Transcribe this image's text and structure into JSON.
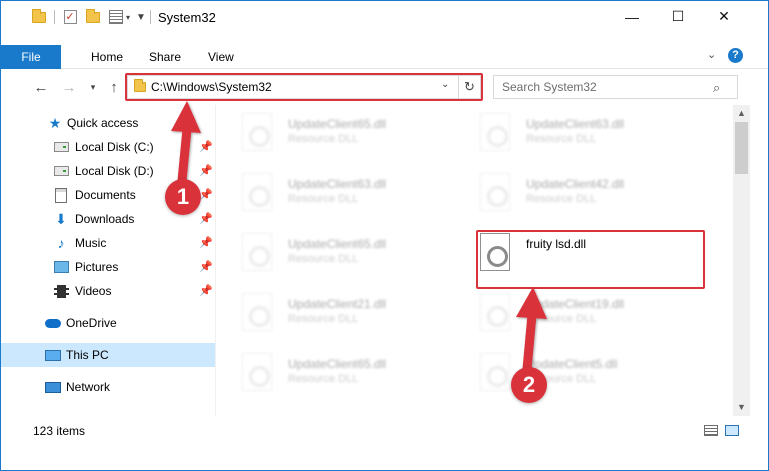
{
  "window": {
    "title": "System32",
    "controls": {
      "minimize": "—",
      "maximize": "☐",
      "close": "✕"
    }
  },
  "ribbon": {
    "tabs": [
      "File",
      "Home",
      "Share",
      "View"
    ]
  },
  "address": {
    "path": "C:\\Windows\\System32",
    "search_placeholder": "Search System32"
  },
  "sidebar": {
    "items": [
      {
        "label": "Quick access",
        "icon": "star-icon",
        "pinned": false
      },
      {
        "label": "Local Disk (C:)",
        "icon": "drive-icon",
        "pinned": true
      },
      {
        "label": "Local Disk (D:)",
        "icon": "drive-icon",
        "pinned": true
      },
      {
        "label": "Documents",
        "icon": "documents-icon",
        "pinned": true
      },
      {
        "label": "Downloads",
        "icon": "downloads-icon",
        "pinned": true
      },
      {
        "label": "Music",
        "icon": "music-icon",
        "pinned": true
      },
      {
        "label": "Pictures",
        "icon": "pictures-icon",
        "pinned": true
      },
      {
        "label": "Videos",
        "icon": "videos-icon",
        "pinned": true
      },
      {
        "label": "OneDrive",
        "icon": "onedrive-icon",
        "pinned": false
      },
      {
        "label": "This PC",
        "icon": "this-pc-icon",
        "pinned": false,
        "selected": true
      },
      {
        "label": "Network",
        "icon": "network-icon",
        "pinned": false
      }
    ]
  },
  "files": [
    {
      "name": "UpdateClient65.dll",
      "type": "Resource DLL"
    },
    {
      "name": "UpdateClient63.dll",
      "type": "Resource DLL"
    },
    {
      "name": "UpdateClient63.dll",
      "type": "Resource DLL"
    },
    {
      "name": "UpdateClient42.dll",
      "type": "Resource DLL"
    },
    {
      "name": "UpdateClient65.dll",
      "type": "Resource DLL"
    },
    {
      "name": "fruity lsd.dll",
      "type": ""
    },
    {
      "name": "UpdateClient21.dll",
      "type": "Resource DLL"
    },
    {
      "name": "UpdateClient19.dll",
      "type": "Resource DLL"
    },
    {
      "name": "UpdateClient65.dll",
      "type": "Resource DLL"
    },
    {
      "name": "UpdateClient5.dll",
      "type": "Resource DLL"
    }
  ],
  "status": {
    "item_count": "123 items"
  },
  "annotations": {
    "step1": "1",
    "step2": "2",
    "highlight_color": "#d9323a"
  },
  "colors": {
    "accent": "#1979ca",
    "selection": "#cce8ff"
  }
}
